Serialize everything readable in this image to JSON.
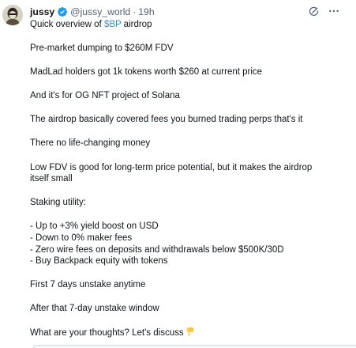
{
  "author": {
    "display_name": "jussy",
    "handle": "@jussy_world",
    "separator": "·",
    "timestamp": "19h",
    "verified": true,
    "verified_color": "#1d9bf0"
  },
  "actions": {
    "grok_icon": "grok-icon",
    "more_icon": "more-icon"
  },
  "post": {
    "intro_prefix": "Quick overview of ",
    "cashtag": "$BP",
    "intro_suffix": " airdrop",
    "p1": "Pre-market dumping to $260M FDV",
    "p2": "MadLad holders got 1k tokens worth $260 at current price",
    "p3": "And it's for OG NFT project of Solana",
    "p4": "The airdrop basically covered fees you burned trading perps that's it",
    "p5": "There no life-changing money",
    "p6_line1": "Low FDV is good for long-term price potential, but it makes the airdrop",
    "p6_line2": "itself small",
    "staking_title": "Staking utility:",
    "bullets": [
      "- Up to +3% yield boost on USD",
      "- Down to 0% maker fees",
      "- Zero wire fees on deposits and withdrawals below $500K/30D",
      "- Buy Backpack equity with tokens"
    ],
    "p8": "First 7 days unstake anytime",
    "p9": "After that 7-day unstake window",
    "p10": "What are your thoughts? Let's discuss",
    "emoji": "pointing-down-hand-emoji",
    "cashtag_color": "#1d9bf0"
  }
}
